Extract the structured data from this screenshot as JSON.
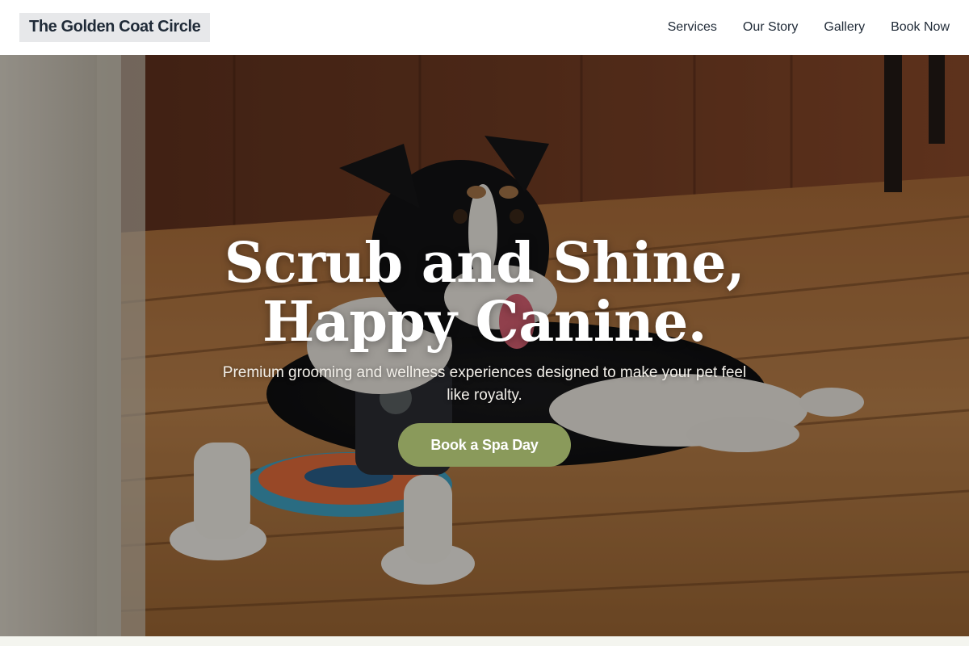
{
  "header": {
    "brand": "The Golden Coat Circle",
    "nav": [
      {
        "label": "Services"
      },
      {
        "label": "Our Story"
      },
      {
        "label": "Gallery"
      },
      {
        "label": "Book Now"
      }
    ]
  },
  "hero": {
    "title_line1": "Scrub and Shine,",
    "title_line2": "Happy Canine.",
    "subtitle": "Premium grooming and wellness experiences designed to make your pet feel like royalty.",
    "cta_label": "Book a Spa Day",
    "image_subject": "dog-lying-on-wooden-deck"
  },
  "colors": {
    "header_bg": "#ffffff",
    "logo_bg": "#e7e8ea",
    "text_dark": "#1f2a37",
    "cta_bg": "#8a9a5b",
    "page_bg": "#f4f5ef"
  }
}
